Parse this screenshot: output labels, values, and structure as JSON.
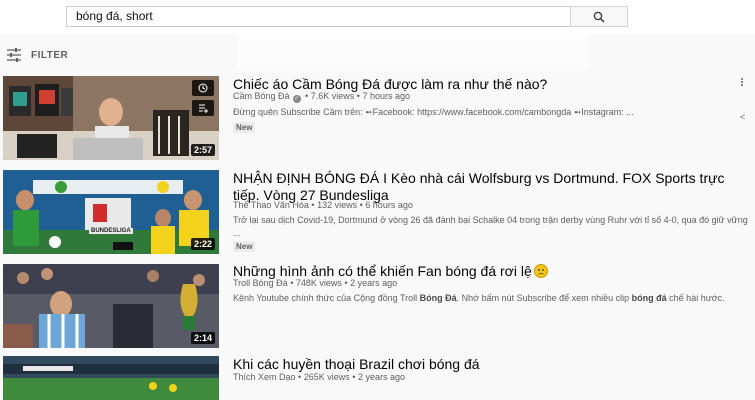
{
  "search": {
    "query": "bóng đá, short"
  },
  "filter": {
    "label": "FILTER"
  },
  "results": [
    {
      "title": "Chiếc áo Cầm Bóng Đá được làm ra như thế nào?",
      "channel": "Cầm Bóng Đá",
      "views": "7.6K views",
      "age": "7 hours ago",
      "description": "Đừng quên Subscribe Cầm trên: ➻Facebook: https://www.facebook.com/cambongda ➻Instagram: ...",
      "badge": "New",
      "duration": "2:57"
    },
    {
      "title": "NHẬN ĐỊNH BÓNG ĐÁ I Kèo nhà cái Wolfsburg vs Dortmund. FOX Sports trực tiếp. Vòng 27 Bundesliga",
      "channel": "Thể Thao Văn Hóa",
      "views": "132 views",
      "age": "6 hours ago",
      "description": "Trở lại sau dịch Covid-19, Dortmund ở vòng 26 đã đánh bại Schalke 04 trong trận derby vùng Ruhr với tỉ số 4-0, qua đó giữ vững ...",
      "badge": "New",
      "duration": "2:22",
      "thumb_text": "BUNDESLIGA"
    },
    {
      "title": "Những hình ảnh có thể khiến Fan bóng đá rơi lệ",
      "channel": "Troll Bóng Đá",
      "views": "748K views",
      "age": "2 years ago",
      "description_part1": "Kênh Youtube chính thức của Cộng đồng Troll ",
      "description_bold1": "Bóng Đá",
      "description_part2": ". Nhớ bấm nút Subscribe để xem nhiều clip ",
      "description_bold2": "bóng đá",
      "description_part3": " chế hài hước.",
      "duration": "2:14"
    },
    {
      "title": "Khi các huyền thoại Brazil chơi bóng đá",
      "channel": "Thích Xem Dạo",
      "views": "265K views",
      "age": "2 years ago"
    }
  ],
  "meta_separator": "•",
  "colors": {
    "accent": "#030303",
    "secondary_text": "#606060",
    "duration_bg": "#000000"
  },
  "icons": [
    "search-icon",
    "filter-icon",
    "watch-later-icon",
    "add-to-queue-icon",
    "more-vert-icon",
    "verified-icon",
    "crying-emoji-icon"
  ]
}
